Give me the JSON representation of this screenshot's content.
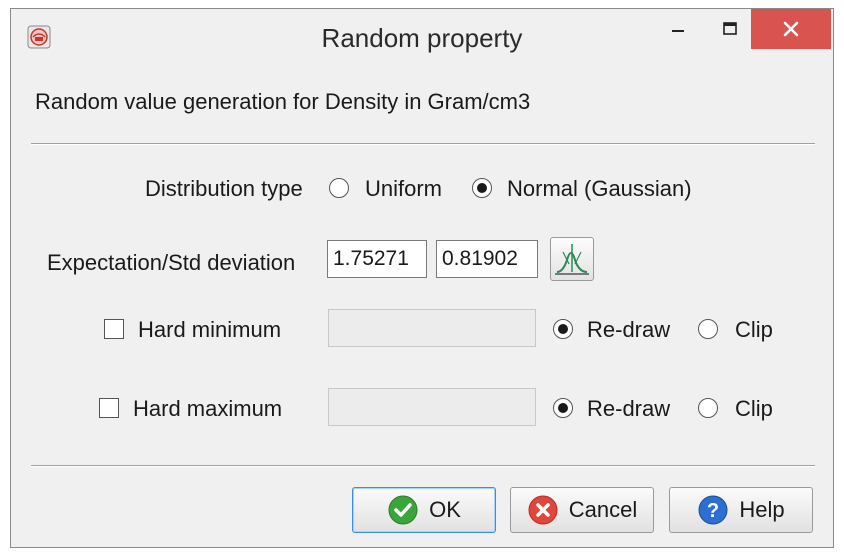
{
  "window": {
    "title": "Random property",
    "app_icon": "app-logo-icon",
    "controls": {
      "minimize": "minimize-icon",
      "maximize": "maximize-icon",
      "close": "close-icon",
      "close_color": "#d9534f"
    }
  },
  "description": "Random value generation for Density in Gram/cm3",
  "distribution": {
    "label": "Distribution type",
    "options": [
      {
        "label": "Uniform",
        "checked": false
      },
      {
        "label": "Normal (Gaussian)",
        "checked": true
      }
    ]
  },
  "expectation": {
    "label": "Expectation/Std deviation",
    "expectation_value": "1.75271",
    "std_value": "0.81902",
    "button_icon": "distribution-chart-icon"
  },
  "hard_minimum": {
    "label": "Hard minimum",
    "checked": false,
    "value": "",
    "options": [
      {
        "label": "Re-draw",
        "checked": true
      },
      {
        "label": "Clip",
        "checked": false
      }
    ]
  },
  "hard_maximum": {
    "label": "Hard maximum",
    "checked": false,
    "value": "",
    "options": [
      {
        "label": "Re-draw",
        "checked": true
      },
      {
        "label": "Clip",
        "checked": false
      }
    ]
  },
  "buttons": {
    "ok": {
      "label": "OK",
      "icon": "check-icon",
      "color": "#3aa53a"
    },
    "cancel": {
      "label": "Cancel",
      "icon": "cancel-icon",
      "color": "#e0463c"
    },
    "help": {
      "label": "Help",
      "icon": "help-icon",
      "color": "#2a6fd1"
    }
  }
}
